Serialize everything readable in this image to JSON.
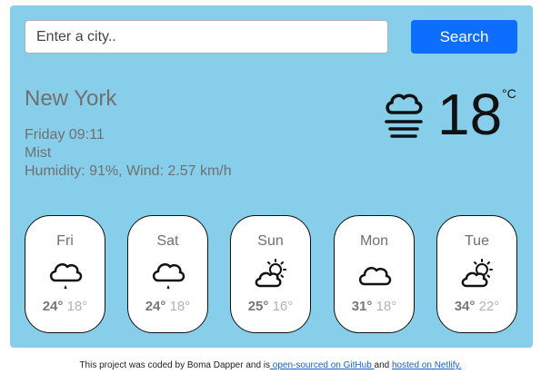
{
  "search": {
    "placeholder": "Enter a city..",
    "button_label": "Search"
  },
  "current": {
    "city": "New York",
    "datetime": "Friday 09:11",
    "description": "Mist",
    "humidity_wind": "Humidity: 91%, Wind: 2.57 km/h",
    "temperature": "18",
    "unit": "°C",
    "icon": "mist-icon"
  },
  "forecast": [
    {
      "day": "Fri",
      "high": "24°",
      "low": "18°",
      "icon": "rain-cloud-icon"
    },
    {
      "day": "Sat",
      "high": "24°",
      "low": "18°",
      "icon": "rain-cloud-icon"
    },
    {
      "day": "Sun",
      "high": "25°",
      "low": "16°",
      "icon": "partly-cloudy-icon"
    },
    {
      "day": "Mon",
      "high": "31°",
      "low": "18°",
      "icon": "cloud-icon"
    },
    {
      "day": "Tue",
      "high": "34°",
      "low": "22°",
      "icon": "partly-cloudy-icon"
    }
  ],
  "footer": {
    "text1": "This project was coded by Boma Dapper and is",
    "github_link": " open-sourced on GitHub ",
    "text2": "and",
    "netlify_link": "hosted on Netlify."
  },
  "colors": {
    "background": "#87ceeb",
    "button": "#0d6efd",
    "link": "#1a5ed6"
  }
}
